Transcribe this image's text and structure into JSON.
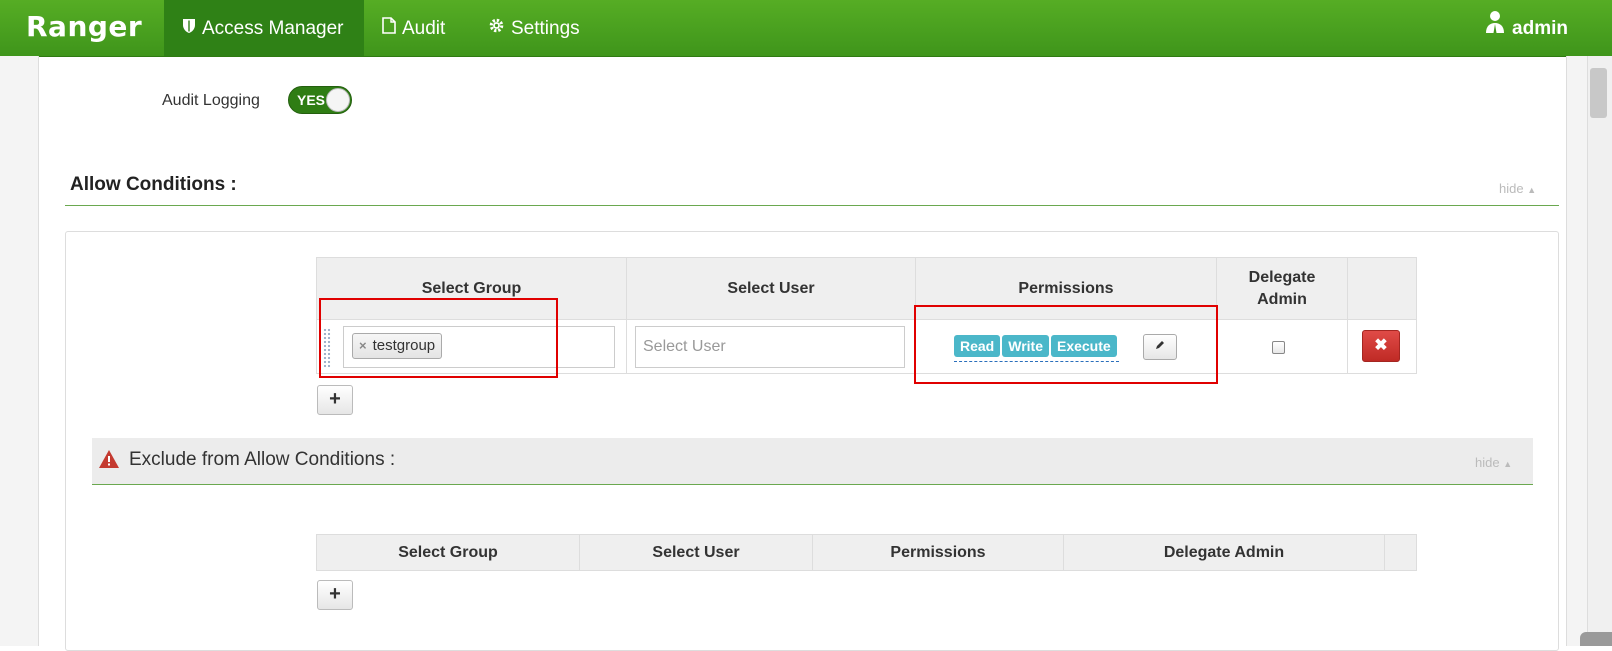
{
  "nav": {
    "brand": "Ranger",
    "items": [
      {
        "label": "Access Manager",
        "icon": "shield-icon",
        "active": true
      },
      {
        "label": "Audit",
        "icon": "file-icon",
        "active": false
      },
      {
        "label": "Settings",
        "icon": "gear-icon",
        "active": false
      }
    ],
    "user": {
      "label": "admin",
      "icon": "user-icon"
    }
  },
  "audit_logging": {
    "label": "Audit Logging",
    "toggle_value": "YES",
    "enabled": true
  },
  "allow_conditions": {
    "title": "Allow Conditions :",
    "hide_label": "hide",
    "columns": [
      "Select Group",
      "Select User",
      "Permissions",
      "Delegate",
      "Admin"
    ],
    "rows": [
      {
        "groups": [
          "testgroup"
        ],
        "user_placeholder": "Select User",
        "permissions": [
          "Read",
          "Write",
          "Execute"
        ],
        "delegate_admin": false
      }
    ],
    "add_label": "+"
  },
  "exclude_conditions": {
    "title": "Exclude from Allow Conditions :",
    "hide_label": "hide",
    "columns": [
      "Select Group",
      "Select User",
      "Permissions",
      "Delegate Admin"
    ],
    "add_label": "+"
  },
  "colors": {
    "nav_green": "#4aa020",
    "permission_tag": "#4bb7c9",
    "delete_red": "#d23a35",
    "highlight_red": "#e00000"
  }
}
